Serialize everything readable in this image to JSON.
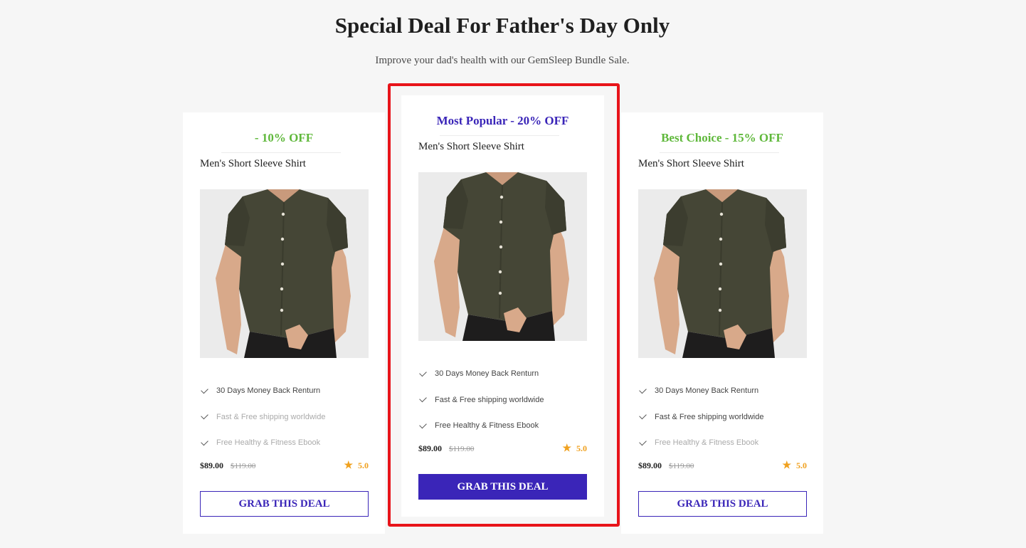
{
  "header": {
    "title": "Special Deal For Father's Day Only",
    "subtitle": "Improve your dad's health with our GemSleep Bundle Sale."
  },
  "colors": {
    "accent": "#3a25b8",
    "green": "#5fb83b",
    "highlight": "#e8141a",
    "star": "#f0a11f"
  },
  "cards": [
    {
      "badge": "- 10% OFF",
      "product_name": "Men's Short Sleeve Shirt",
      "features": [
        "30 Days Money Back Renturn",
        "Fast & Free shipping worldwide",
        "Free Healthy & Fitness Ebook"
      ],
      "price": "$89.00",
      "old_price": "$119.00",
      "rating": "5.0",
      "button_label": "GRAB THIS DEAL"
    },
    {
      "badge": "Most Popular - 20% OFF",
      "product_name": "Men's Short Sleeve Shirt",
      "features": [
        "30 Days Money Back Renturn",
        "Fast & Free shipping worldwide",
        "Free Healthy & Fitness Ebook"
      ],
      "price": "$89.00",
      "old_price": "$119.00",
      "rating": "5.0",
      "button_label": "GRAB THIS DEAL"
    },
    {
      "badge": "Best Choice - 15% OFF",
      "product_name": "Men's Short Sleeve Shirt",
      "features": [
        "30 Days Money Back Renturn",
        "Fast & Free shipping worldwide",
        "Free Healthy & Fitness Ebook"
      ],
      "price": "$89.00",
      "old_price": "$119.00",
      "rating": "5.0",
      "button_label": "GRAB THIS DEAL"
    }
  ]
}
